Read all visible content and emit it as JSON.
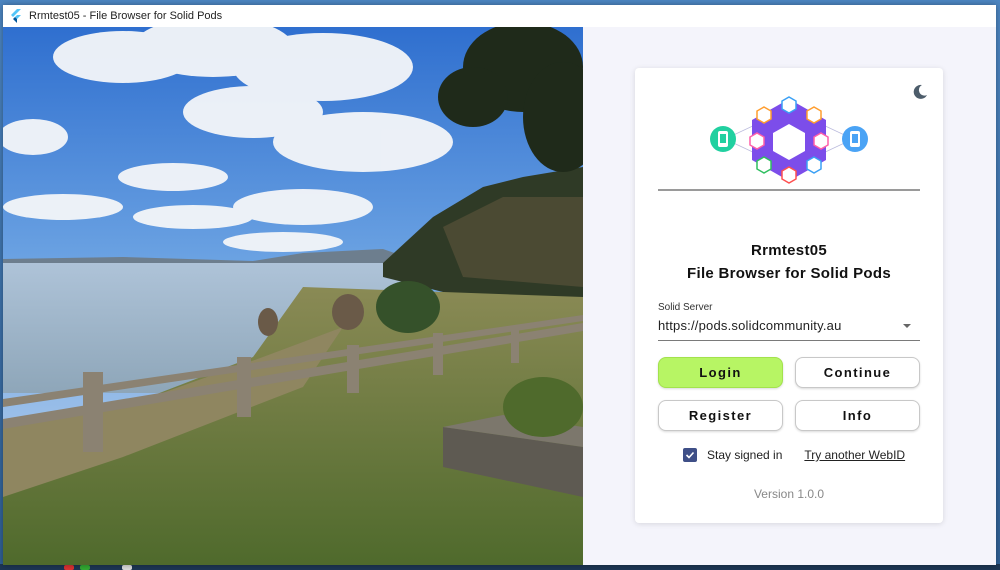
{
  "window": {
    "title": "Rrmtest05 - File Browser for Solid Pods"
  },
  "photo": {
    "description_icon": "landscape-photo"
  },
  "card": {
    "theme_icon": "moon-icon",
    "logo_icon": "solid-pods-network-logo",
    "app_name": "Rrmtest05",
    "subtitle": "File Browser for Solid Pods",
    "server": {
      "label": "Solid Server",
      "value": "https://pods.solidcommunity.au"
    },
    "buttons": {
      "login": "Login",
      "continue": "Continue",
      "register": "Register",
      "info": "Info"
    },
    "stay_signed_in": {
      "label": "Stay signed in",
      "checked": true
    },
    "webid_link": "Try another WebID",
    "version": "Version 1.0.0"
  },
  "colors": {
    "primary_button": "#b7f564",
    "checkbox": "#3f4f87",
    "pane_background": "#f4f4fb"
  }
}
